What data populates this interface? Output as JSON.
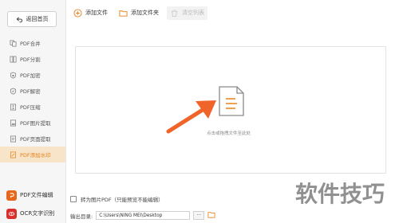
{
  "sidebar": {
    "back_label": "返回首页",
    "items": [
      {
        "label": "PDF合并",
        "icon": "merge-icon",
        "active": false
      },
      {
        "label": "PDF分割",
        "icon": "split-icon",
        "active": false
      },
      {
        "label": "PDF加密",
        "icon": "lock-shield-icon",
        "active": false
      },
      {
        "label": "PDF解密",
        "icon": "unlock-shield-icon",
        "active": false
      },
      {
        "label": "PDF压缩",
        "icon": "compress-icon",
        "active": false
      },
      {
        "label": "PDF图片提取",
        "icon": "image-extract-icon",
        "active": false
      },
      {
        "label": "PDF页面提取",
        "icon": "page-extract-icon",
        "active": false
      },
      {
        "label": "PDF添加水印",
        "icon": "watermark-icon",
        "active": true
      }
    ],
    "promos": [
      {
        "label": "PDF文件编辑",
        "icon": "pdf-edit-icon",
        "color": "#e8661a"
      },
      {
        "label": "OCR文字识别",
        "icon": "ocr-icon",
        "color": "#d9302c"
      }
    ]
  },
  "toolbar": {
    "add_file": "添加文件",
    "add_folder": "添加文件夹",
    "clear_list": "清空列表"
  },
  "drop_area": {
    "hint": "点击或拖拽文件至此处"
  },
  "options": {
    "convert_label": "转为图片PDF（只能预览不能编辑）",
    "output_label": "输出目录:",
    "output_path": "C:\\Users\\NING MEI\\Desktop",
    "browse_label": "···"
  },
  "watermark": {
    "text": "软件技巧"
  },
  "colors": {
    "accent": "#e8801a",
    "active_bg": "#f7e4c9",
    "arrow": "#f0642a"
  }
}
